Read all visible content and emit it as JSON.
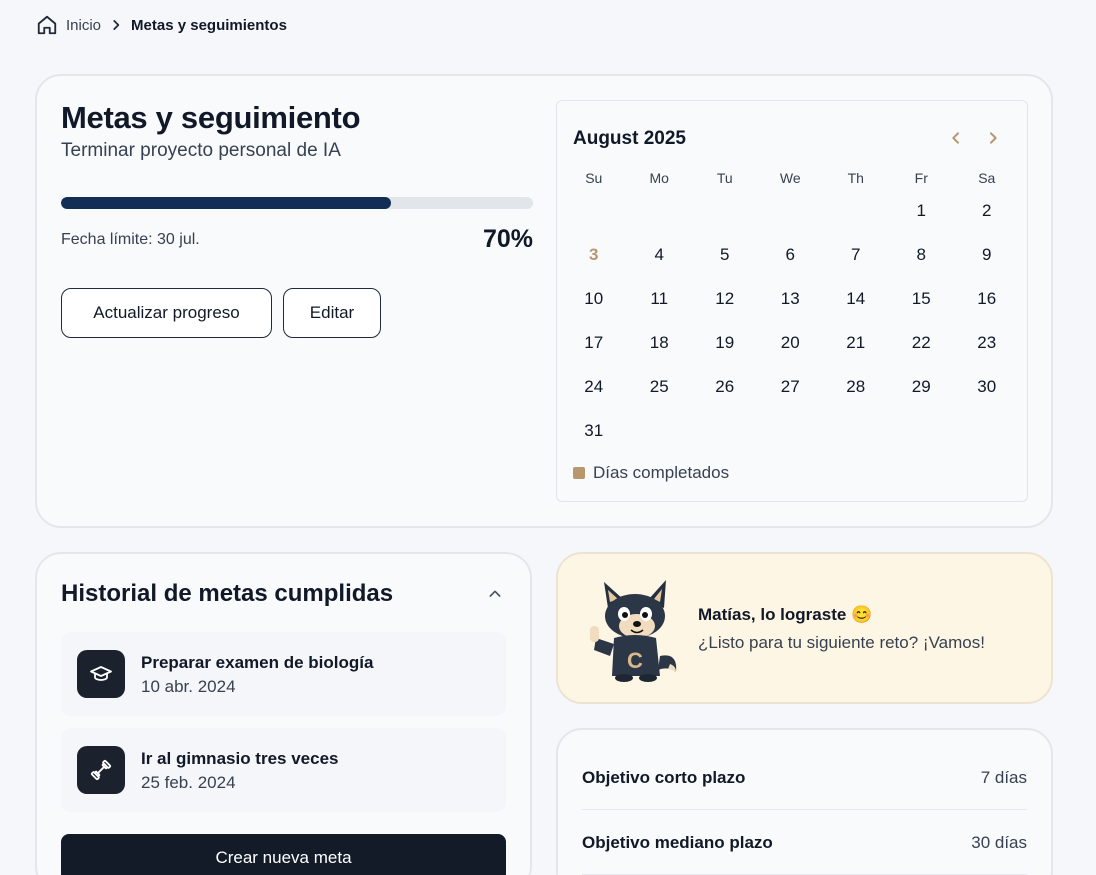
{
  "breadcrumb": {
    "home_label": "Inicio",
    "current": "Metas y seguimientos"
  },
  "goal": {
    "title": "Metas y seguimiento",
    "subtitle": "Terminar proyecto personal de IA",
    "progress_fraction": 0.7,
    "deadline": "Fecha límite: 30 jul.",
    "progress_label": "70%",
    "update_button": "Actualizar progreso",
    "edit_button": "Editar"
  },
  "calendar": {
    "month_title": "August 2025",
    "weekdays": [
      "Su",
      "Mo",
      "Tu",
      "We",
      "Th",
      "Fr",
      "Sa"
    ],
    "weeks": [
      [
        "",
        "",
        "",
        "",
        "",
        "1",
        "2"
      ],
      [
        "3",
        "4",
        "5",
        "6",
        "7",
        "8",
        "9"
      ],
      [
        "10",
        "11",
        "12",
        "13",
        "14",
        "15",
        "16"
      ],
      [
        "17",
        "18",
        "19",
        "20",
        "21",
        "22",
        "23"
      ],
      [
        "24",
        "25",
        "26",
        "27",
        "28",
        "29",
        "30"
      ],
      [
        "31",
        "",
        "",
        "",
        "",
        "",
        ""
      ]
    ],
    "highlighted_day": "3",
    "legend_label": "Días completados",
    "accent_color": "#b8976e"
  },
  "history": {
    "title": "Historial de metas cumplidas",
    "items": [
      {
        "name": "Preparar examen de biología",
        "date": "10 abr. 2024",
        "icon": "graduation-cap-icon"
      },
      {
        "name": "Ir al gimnasio tres veces",
        "date": "25 feb. 2024",
        "icon": "dumbbell-icon"
      }
    ],
    "create_button": "Crear nueva meta"
  },
  "congrats": {
    "title": "Matías, lo lograste 😊",
    "text": "¿Listo para tu siguiente reto? ¡Vamos!"
  },
  "objectives": [
    {
      "label": "Objetivo corto plazo",
      "value": "7 días"
    },
    {
      "label": "Objetivo mediano plazo",
      "value": "30 días"
    }
  ]
}
